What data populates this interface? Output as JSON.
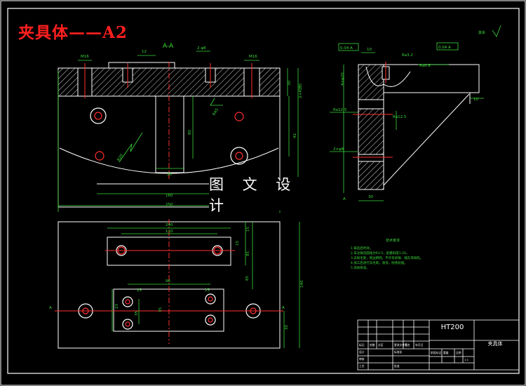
{
  "title": "夹具体——A2",
  "watermark": "图 文 设 计",
  "section_label": "A-A",
  "roughness_note": "其余",
  "material": "HT200",
  "part_name": "夹具体",
  "notes": {
    "heading": "技术要求",
    "lines": [
      "1.铸造后时效。",
      "2.未注铸造圆角为R3-5，起模斜度1:20。",
      "3.去除毛刺，锐边倒钝，不许有砂眼、缩孔等缺陷。",
      "4.加工后进行去毛刺，清洗，防锈处理。",
      "5.涂防锈漆。"
    ]
  },
  "dimensions": {
    "front": [
      "M16",
      "M16",
      "12",
      "2-φ8",
      "30",
      "30",
      "2×45°",
      "80",
      "42",
      "R45",
      "R20",
      "30",
      "160",
      "250"
    ],
    "side": [
      "10",
      "0.04 A",
      "0.04 A",
      "Ra3.2",
      "Ra12.5",
      "Ra12.5",
      "4×φ20",
      "2×φ8",
      "Ra0.8",
      "30",
      "10",
      "A"
    ],
    "top": [
      "240",
      "110",
      "15",
      "15",
      "85",
      "85",
      "96",
      "25",
      "25",
      "23",
      "35",
      "35",
      "140",
      "30",
      "A",
      "A"
    ]
  },
  "title_block": {
    "labels": [
      "标记",
      "处数",
      "分区",
      "更改文件号",
      "签名",
      "年月日",
      "设计",
      "标准化",
      "审核",
      "工艺",
      "批准",
      "阶段标记",
      "重量",
      "比例",
      "1:1"
    ]
  }
}
